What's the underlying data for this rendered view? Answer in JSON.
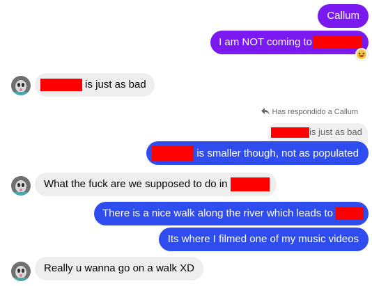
{
  "colors": {
    "sent_purple": "#7a19f0",
    "sent_blue": "#2f4cee",
    "received_bg": "#eeeeee",
    "redaction": "#ff0000"
  },
  "messages": {
    "m1": {
      "text": "Callum"
    },
    "m2": {
      "text": "I am NOT coming to",
      "reaction": "laughing-emoji"
    },
    "m3": {
      "text_after": " is just as bad"
    },
    "reply": {
      "note": "Has respondido a Callum",
      "quoted_after": "is just as bad",
      "text_after": " is smaller though, not as populated"
    },
    "m5": {
      "text": "What the fuck are we supposed to do in"
    },
    "m6": {
      "text": "There is a nice walk along the river which leads to"
    },
    "m7": {
      "text": "Its where I filmed one of my music videos"
    },
    "m8": {
      "text": "Really u wanna go on a walk XD"
    }
  }
}
